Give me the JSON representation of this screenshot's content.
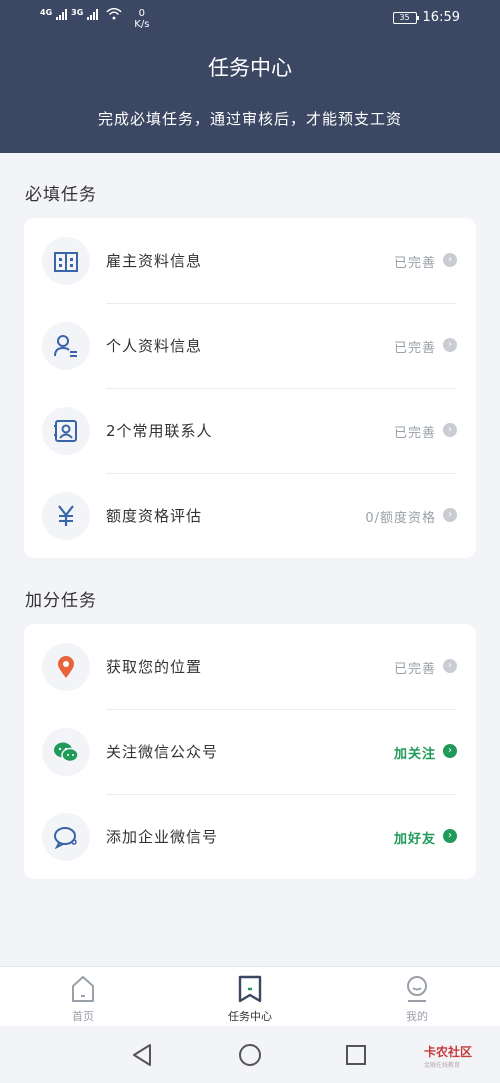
{
  "status_bar": {
    "net1": "4G",
    "net2": "3G",
    "speed_value": "0",
    "speed_unit": "K/s",
    "battery": "35",
    "time": "16:59"
  },
  "header": {
    "title": "任务中心",
    "subtitle": "完成必填任务，通过审核后，才能预支工资"
  },
  "required_section": {
    "title": "必填任务",
    "items": [
      {
        "label": "雇主资料信息",
        "status": "已完善",
        "icon": "building-icon"
      },
      {
        "label": "个人资料信息",
        "status": "已完善",
        "icon": "person-icon"
      },
      {
        "label": "2个常用联系人",
        "status": "已完善",
        "icon": "contact-card-icon"
      },
      {
        "label": "额度资格评估",
        "status": "0/额度资格",
        "icon": "yuan-icon"
      }
    ]
  },
  "bonus_section": {
    "title": "加分任务",
    "items": [
      {
        "label": "获取您的位置",
        "status": "已完善",
        "icon": "location-pin-icon"
      },
      {
        "label": "关注微信公众号",
        "status": "加关注",
        "icon": "wechat-icon"
      },
      {
        "label": "添加企业微信号",
        "status": "加好友",
        "icon": "enterprise-wechat-icon"
      }
    ]
  },
  "tabbar": {
    "tabs": [
      {
        "label": "首页"
      },
      {
        "label": "任务中心"
      },
      {
        "label": "我的"
      }
    ]
  },
  "watermark": {
    "title": "卡农社区",
    "subtitle": "金融在线教育"
  },
  "colors": {
    "header_bg": "#3c4863",
    "accent_blue": "#3a64a8",
    "accent_green": "#1f9a58",
    "location_orange": "#e8633a"
  }
}
